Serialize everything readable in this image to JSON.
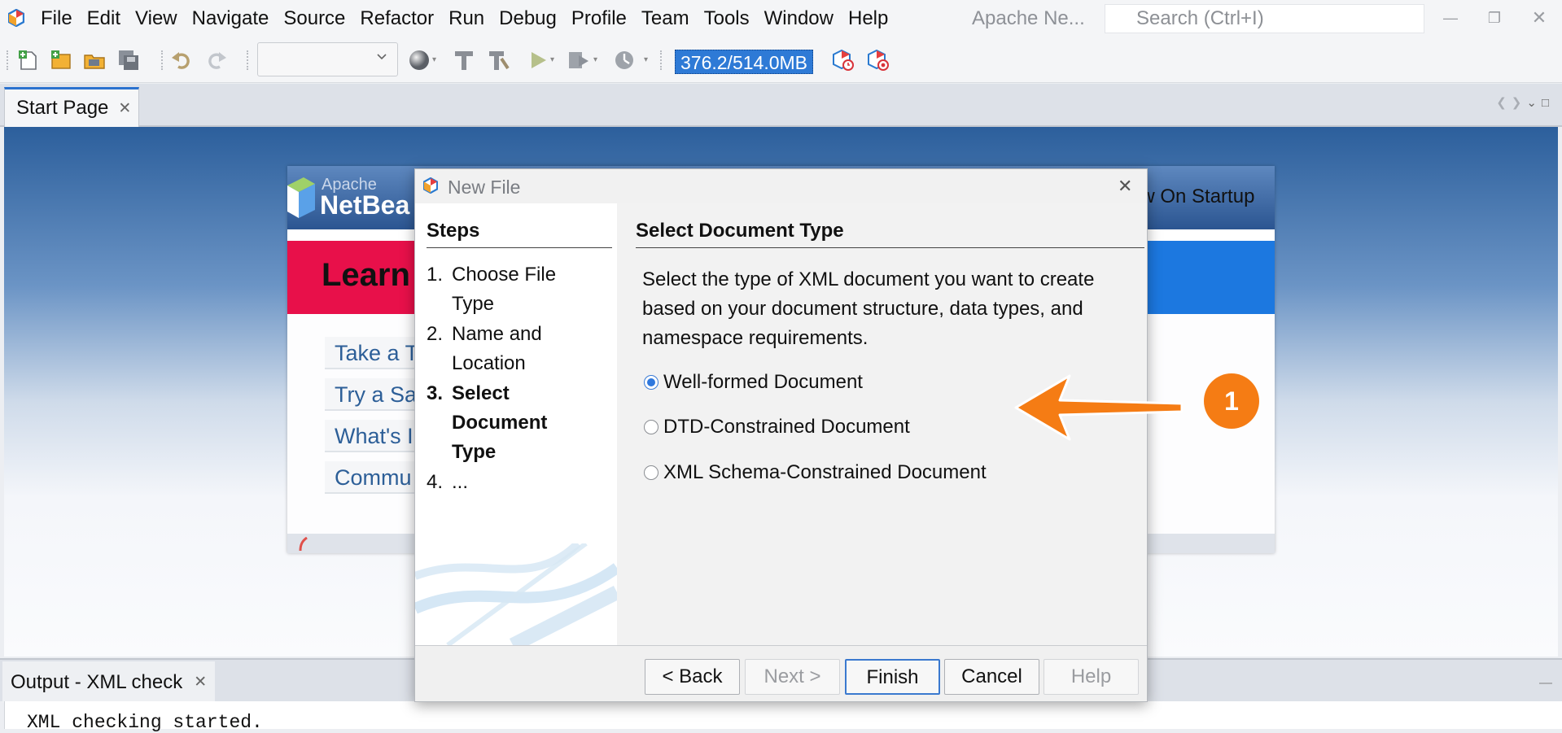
{
  "menubar": {
    "items": [
      "File",
      "Edit",
      "View",
      "Navigate",
      "Source",
      "Refactor",
      "Run",
      "Debug",
      "Profile",
      "Team",
      "Tools",
      "Window",
      "Help"
    ],
    "window_title": "Apache Ne...",
    "search_placeholder": "Search (Ctrl+I)",
    "icons": {
      "logo": "netbeans-logo-icon",
      "search": "search-icon",
      "minimize": "minimize-icon",
      "restore": "restore-icon",
      "close": "close-icon"
    }
  },
  "toolbar": {
    "memory": "376.2/514.0MB",
    "config_value": "",
    "icons": [
      "new-file-icon",
      "new-project-icon",
      "open-project-icon",
      "save-all-icon",
      "undo-icon",
      "redo-icon",
      "globe-icon",
      "build-icon",
      "clean-build-icon",
      "run-icon",
      "debug-icon",
      "profile-icon",
      "gc-icon",
      "profiler-snapshot-icon"
    ]
  },
  "editor": {
    "tab_label": "Start Page"
  },
  "start_page": {
    "logo_apache": "Apache",
    "logo_netbeans": "NetBea",
    "show_on_startup": "ow On Startup",
    "banner_title": "Learn",
    "links": [
      "Take a T",
      "Try a Sa",
      "What's I",
      "Commu"
    ]
  },
  "dialog": {
    "title": "New File",
    "steps_heading": "Steps",
    "steps": [
      {
        "num": "1.",
        "label": "Choose File Type",
        "active": false
      },
      {
        "num": "2.",
        "label": "Name and Location",
        "active": false
      },
      {
        "num": "3.",
        "label": "Select Document Type",
        "active": true
      },
      {
        "num": "4.",
        "label": "...",
        "active": false
      }
    ],
    "content_heading": "Select Document Type",
    "description": "Select the type of XML document you want to create based on your document structure, data types, and namespace requirements.",
    "options": [
      {
        "label": "Well-formed Document",
        "selected": true
      },
      {
        "label": "DTD-Constrained Document",
        "selected": false
      },
      {
        "label": "XML Schema-Constrained Document",
        "selected": false
      }
    ],
    "buttons": {
      "back": "< Back",
      "next": "Next >",
      "finish": "Finish",
      "cancel": "Cancel",
      "help": "Help"
    }
  },
  "output": {
    "tab_label": "Output - XML check",
    "line": "XML checking started."
  },
  "annotation": {
    "badge": "1",
    "color": "#f57c14"
  }
}
